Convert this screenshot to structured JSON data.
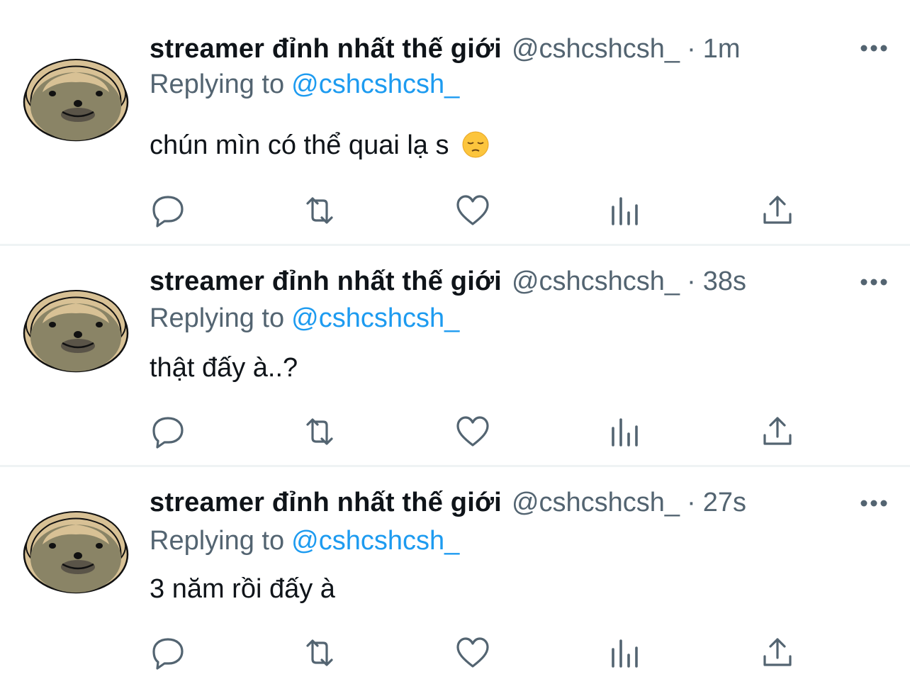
{
  "tweets": [
    {
      "display_name": "streamer đỉnh nhất thế giới",
      "handle": "@cshcshcsh_",
      "separator": "·",
      "time": "1m",
      "replying_label": "Replying to",
      "replying_to": "@cshcshcsh_",
      "text": "chún mìn có thể quai lạ s",
      "emoji": "pensive-face-emoji"
    },
    {
      "display_name": "streamer đỉnh nhất thế giới",
      "handle": "@cshcshcsh_",
      "separator": "·",
      "time": "38s",
      "replying_label": "Replying to",
      "replying_to": "@cshcshcsh_",
      "text": "thật đấy à..?"
    },
    {
      "display_name": "streamer đỉnh nhất thế giới",
      "handle": "@cshcshcsh_",
      "separator": "·",
      "time": "27s",
      "replying_label": "Replying to",
      "replying_to": "@cshcshcsh_",
      "text": "3 năm rồi đấy à"
    }
  ],
  "action_icons": [
    "reply-icon",
    "retweet-icon",
    "like-icon",
    "analytics-icon",
    "share-icon"
  ],
  "colors": {
    "text_primary": "#0f1419",
    "text_secondary": "#536471",
    "mention": "#1d9bf0",
    "divider": "#eff3f4",
    "avatar_fur": "#8a8466",
    "avatar_hair": "#d8c195"
  }
}
